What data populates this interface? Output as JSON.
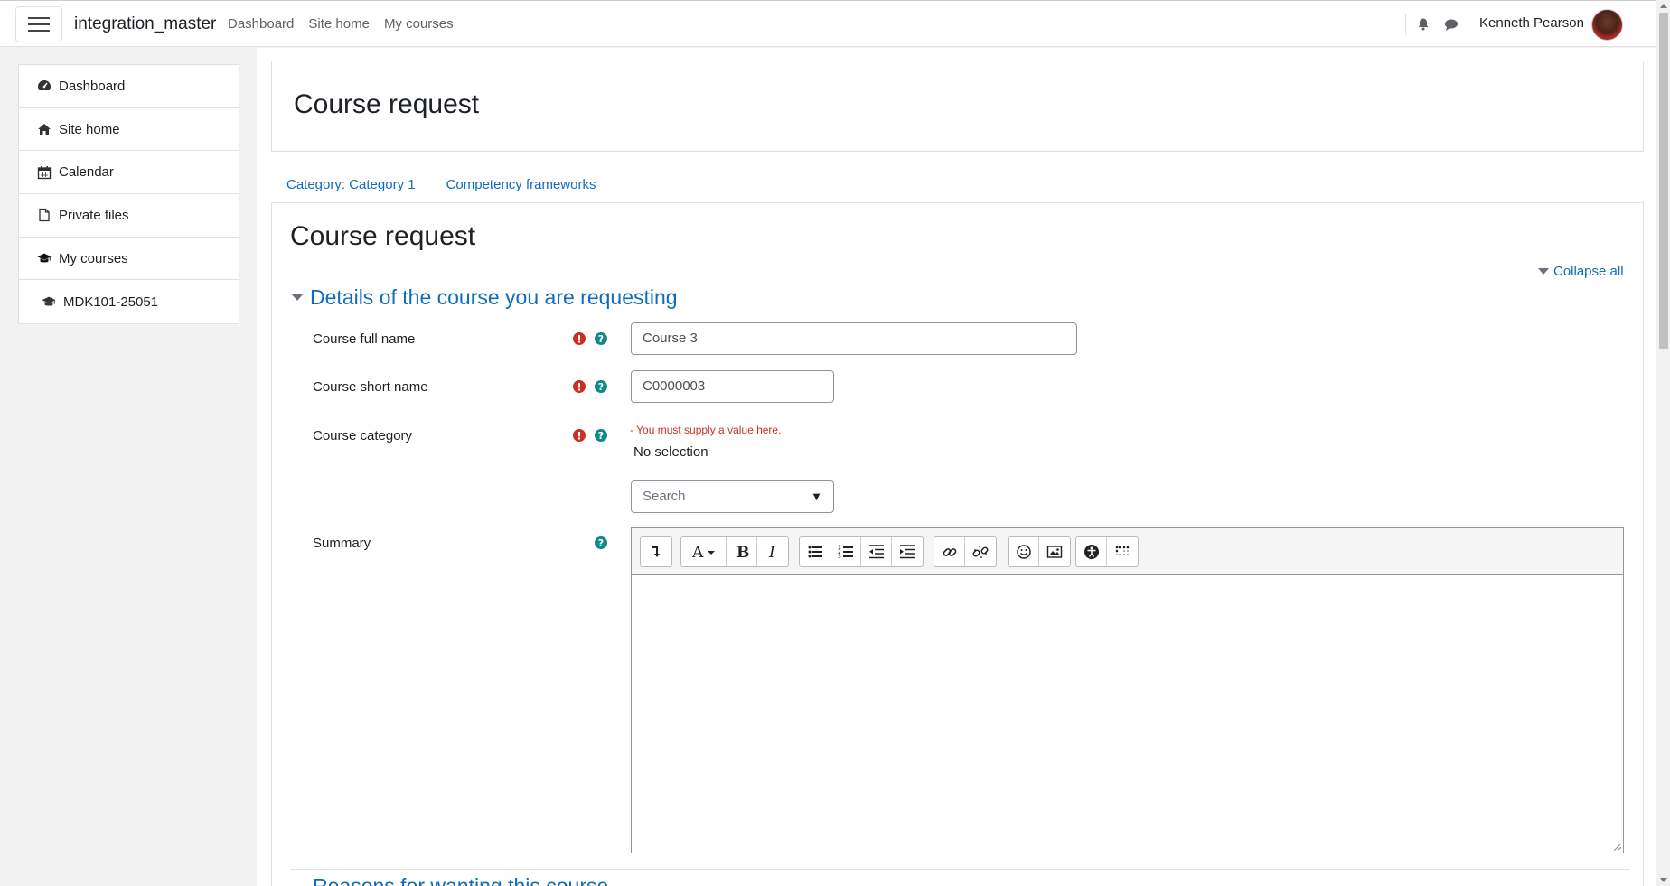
{
  "navbar": {
    "brand": "integration_master",
    "links": [
      "Dashboard",
      "Site home",
      "My courses"
    ],
    "user_name": "Kenneth Pearson"
  },
  "sidebar": {
    "items": [
      {
        "label": "Dashboard",
        "icon": "dashboard-icon"
      },
      {
        "label": "Site home",
        "icon": "home-icon"
      },
      {
        "label": "Calendar",
        "icon": "calendar-icon"
      },
      {
        "label": "Private files",
        "icon": "file-icon"
      },
      {
        "label": "My courses",
        "icon": "graduation-cap-icon"
      },
      {
        "label": "MDK101-25051",
        "icon": "graduation-cap-icon"
      }
    ]
  },
  "header": {
    "title": "Course request"
  },
  "secondary_nav": {
    "category_link": "Category: Category 1",
    "competency_link": "Competency frameworks"
  },
  "content": {
    "title": "Course request",
    "collapse_all": "Collapse all",
    "section_title": "Details of the course you are requesting",
    "next_section_title": "Reasons for wanting this course"
  },
  "form": {
    "full_name_label": "Course full name",
    "full_name_value": "Course 3",
    "short_name_label": "Course short name",
    "short_name_value": "C0000003",
    "category_label": "Course category",
    "category_error": "- You must supply a value here.",
    "category_selection": "No selection",
    "category_search_placeholder": "Search",
    "summary_label": "Summary"
  },
  "colors": {
    "link": "#0f6cbf",
    "error": "#ca3120",
    "help": "#0f8a8a"
  }
}
